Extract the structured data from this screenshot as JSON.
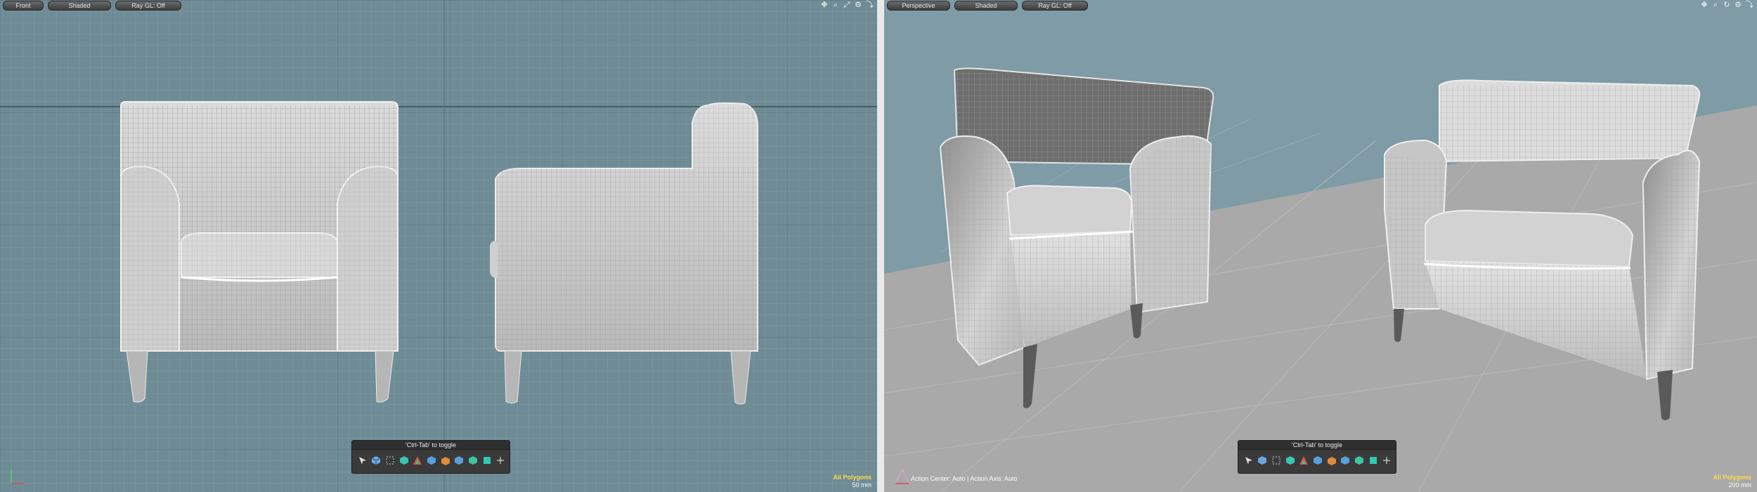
{
  "front_view": {
    "buttons": [
      "Front",
      "Shaded",
      "Ray GL: Off"
    ],
    "toolbar_hint": "'Ctrl-Tab' to toggle",
    "status": {
      "polygons": "All Polygons",
      "scale": "50 mm"
    }
  },
  "perspective_view": {
    "buttons": [
      "Perspective",
      "Shaded",
      "Ray GL: Off"
    ],
    "toolbar_hint": "'Ctrl-Tab' to toggle",
    "action_center": "Action Center: Auto | Action Axis: Auto",
    "status": {
      "polygons": "All Polygons",
      "scale": "200 mm"
    }
  },
  "icons": {
    "corner": [
      "move-view-icon",
      "zoom-icon",
      "maximize-icon",
      "settings-icon",
      "expand-icon"
    ],
    "toolbar": [
      "select-icon",
      "cube-icon",
      "marquee-icon",
      "box-icon",
      "transform-icon",
      "stretch-icon",
      "bevel-icon",
      "shade-icon",
      "cube-icon",
      "extrude-icon",
      "add-icon"
    ]
  },
  "colors": {
    "front_bg": "#6f8c96",
    "persp_bg": "#7e9ba6",
    "floor": "#a9a9a9",
    "status_yellow": "#ffd84a"
  }
}
